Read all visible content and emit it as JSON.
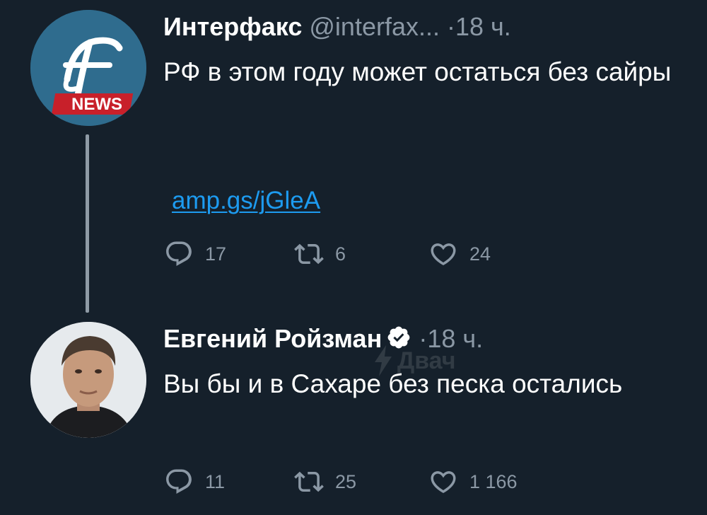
{
  "tweets": [
    {
      "display_name": "Интерфакс",
      "handle": "@interfax...",
      "separator": "·",
      "time": "18 ч.",
      "text": "РФ в этом году может остаться без сайры",
      "link": "amp.gs/jGleA",
      "avatar_logo_letter": "F",
      "avatar_logo_badge": "NEWS",
      "actions": {
        "replies": "17",
        "retweets": "6",
        "likes": "24"
      }
    },
    {
      "display_name": "Евгений Ройзман",
      "verified": true,
      "separator": "·",
      "time": "18 ч.",
      "text": "Вы бы и в Сахаре без песка остались",
      "actions": {
        "replies": "11",
        "retweets": "25",
        "likes": "1 166"
      }
    }
  ],
  "watermark": "Двач",
  "icons": {
    "reply": "reply-icon",
    "retweet": "retweet-icon",
    "like": "heart-icon",
    "verified": "verified-badge-icon"
  },
  "colors": {
    "background": "#15202b",
    "text": "#ffffff",
    "muted": "#8b98a5",
    "link": "#1d9bf0",
    "thread_line": "#8f9ba6"
  }
}
